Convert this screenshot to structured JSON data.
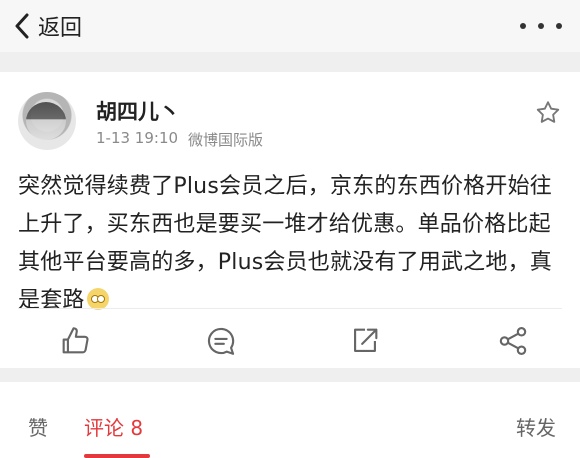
{
  "nav": {
    "back_label": "返回"
  },
  "post": {
    "username": "胡四儿丶",
    "time": "1-13 19:10",
    "source": "微博国际版",
    "text": "突然觉得续费了Plus会员之后，京东的东西价格开始往上升了，买东西也是要买一堆才给优惠。单品价格比起其他平台要高的多，Plus会员也就没有了用武之地，真是套路"
  },
  "tabs": {
    "likes": "赞",
    "comments": "评论 8",
    "reposts": "转发"
  },
  "colors": {
    "accent": "#e4393c"
  }
}
